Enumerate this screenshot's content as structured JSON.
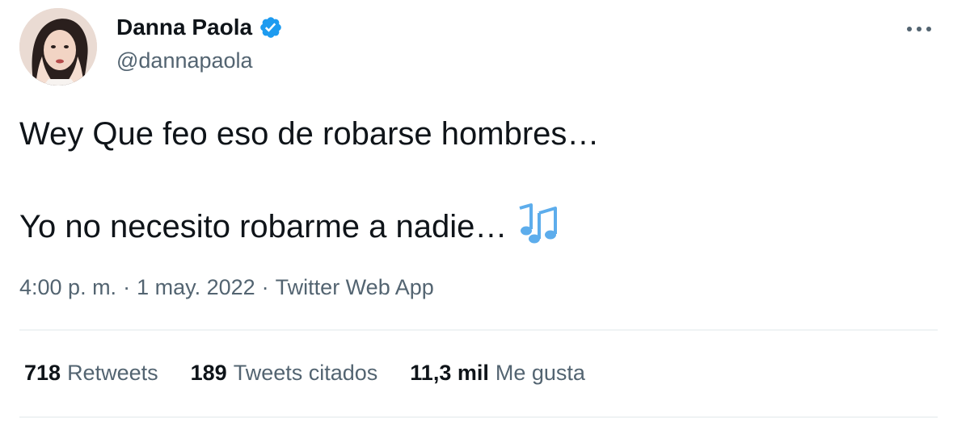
{
  "user": {
    "display_name": "Danna Paola",
    "handle": "@dannapaola",
    "verified": true
  },
  "tweet": {
    "line1": "Wey Que feo eso de robarse hombres…",
    "line2": "Yo no necesito robarme a nadie…",
    "emoji": "musical-notes"
  },
  "meta": {
    "time": "4:00 p. m.",
    "separator": "·",
    "date": "1 may. 2022",
    "source": "Twitter Web App"
  },
  "stats": {
    "retweets_count": "718",
    "retweets_label": "Retweets",
    "quotes_count": "189",
    "quotes_label": "Tweets citados",
    "likes_count": "11,3 mil",
    "likes_label": "Me gusta"
  },
  "colors": {
    "text": "#0f1419",
    "secondary": "#536471",
    "verified": "#1d9bf0",
    "divider": "#eff3f4",
    "emoji": "#5dadec"
  }
}
